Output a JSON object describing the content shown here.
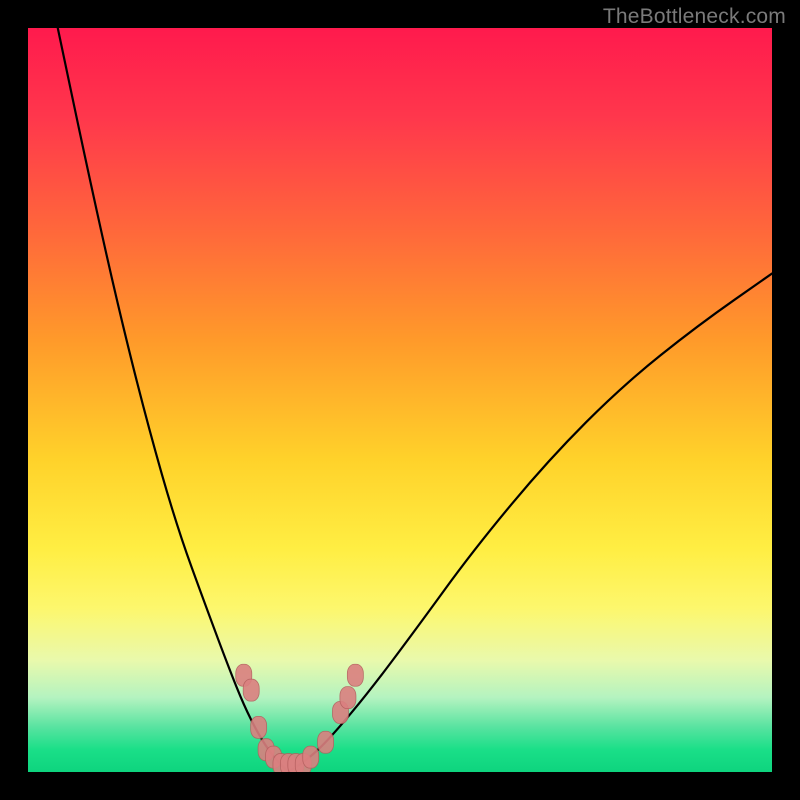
{
  "watermark": "TheBottleneck.com",
  "chart_data": {
    "type": "line",
    "title": "",
    "xlabel": "",
    "ylabel": "",
    "xlim": [
      0,
      100
    ],
    "ylim": [
      0,
      100
    ],
    "grid": false,
    "legend": false,
    "notes": "V-shaped bottleneck curve on gradient background; vertical axis ≈ bottleneck %, minimum ≈ 0 near x ≈ 35.",
    "series": [
      {
        "name": "left-branch",
        "x": [
          4,
          8,
          12,
          16,
          20,
          24,
          27,
          29,
          31,
          33,
          35
        ],
        "y": [
          100,
          81,
          63,
          47,
          33,
          22,
          14,
          9,
          5,
          2,
          0
        ]
      },
      {
        "name": "right-branch",
        "x": [
          35,
          38,
          41,
          46,
          52,
          60,
          70,
          80,
          90,
          100
        ],
        "y": [
          0,
          2,
          5,
          11,
          19,
          30,
          42,
          52,
          60,
          67
        ]
      }
    ],
    "markers": {
      "name": "highlighted-points",
      "color": "#db8080",
      "points": [
        {
          "x": 29,
          "y": 13
        },
        {
          "x": 30,
          "y": 11
        },
        {
          "x": 31,
          "y": 6
        },
        {
          "x": 32,
          "y": 3
        },
        {
          "x": 33,
          "y": 2
        },
        {
          "x": 34,
          "y": 1
        },
        {
          "x": 35,
          "y": 1
        },
        {
          "x": 36,
          "y": 1
        },
        {
          "x": 37,
          "y": 1
        },
        {
          "x": 38,
          "y": 2
        },
        {
          "x": 40,
          "y": 4
        },
        {
          "x": 42,
          "y": 8
        },
        {
          "x": 43,
          "y": 10
        },
        {
          "x": 44,
          "y": 13
        }
      ]
    }
  }
}
